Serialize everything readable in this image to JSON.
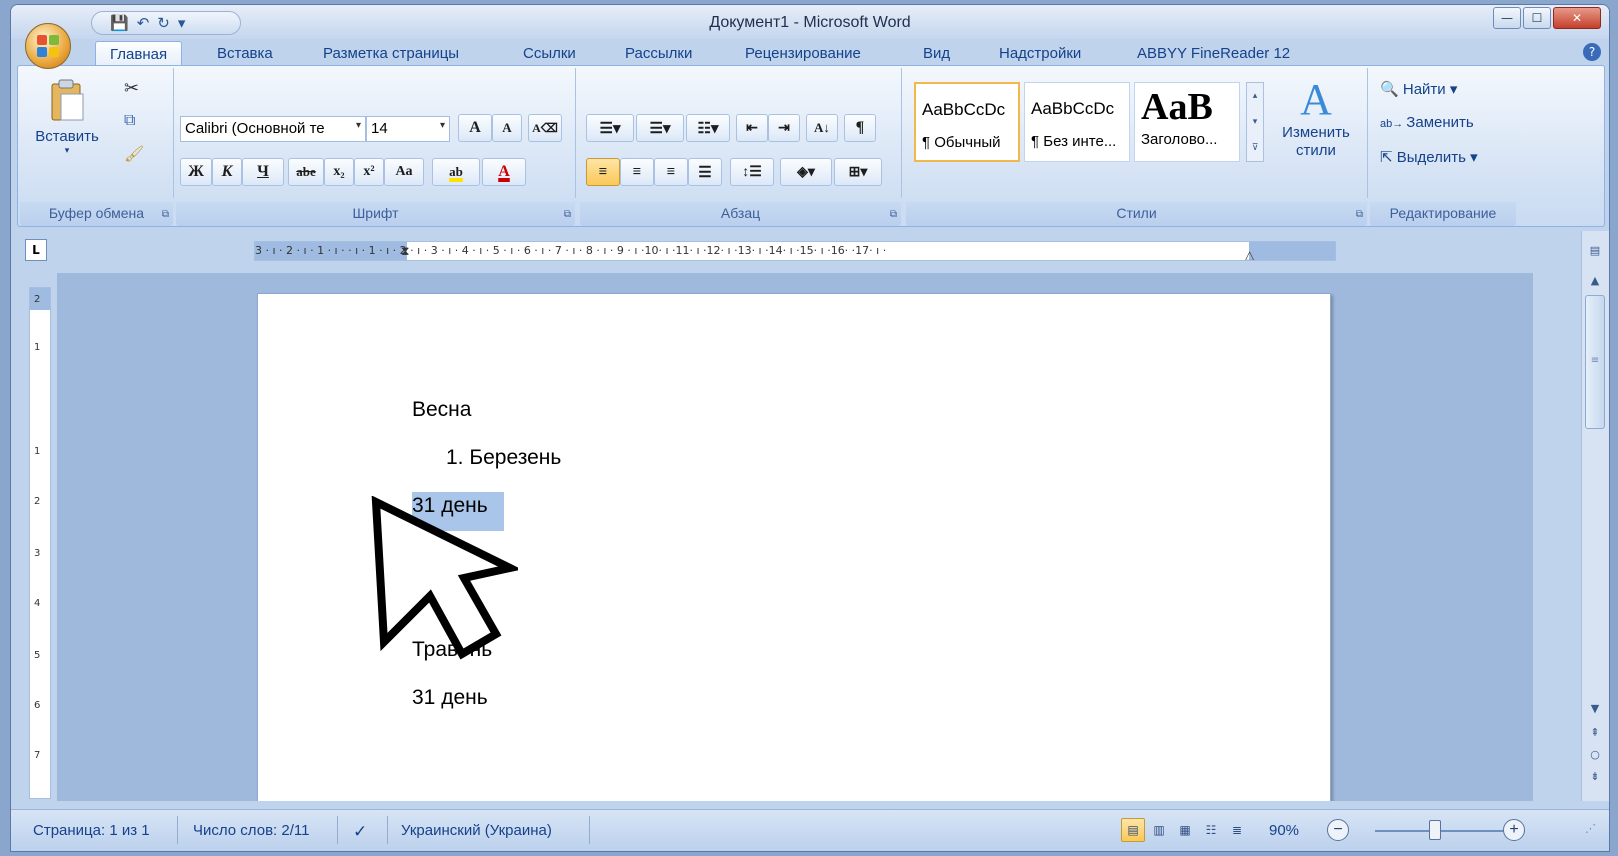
{
  "window": {
    "title": "Документ1 - Microsoft Word",
    "controls": {
      "minimize": "—",
      "maximize": "☐",
      "close": "✕"
    }
  },
  "quick_access": {
    "save": "💾",
    "undo": "↶",
    "redo": "↻",
    "more": "▾"
  },
  "tabs": [
    "Главная",
    "Вставка",
    "Разметка страницы",
    "Ссылки",
    "Рассылки",
    "Рецензирование",
    "Вид",
    "Надстройки",
    "ABBYY FineReader 12"
  ],
  "active_tab": "Главная",
  "help": "?",
  "ribbon": {
    "clipboard": {
      "label": "Буфер обмена",
      "paste": "Вставить"
    },
    "font": {
      "label": "Шрифт",
      "family": "Calibri (Основной те",
      "size": "14",
      "grow": "A",
      "shrink": "A",
      "bold": "Ж",
      "italic": "К",
      "underline": "Ч",
      "strike": "abe",
      "subscript": "x₂",
      "superscript": "x²",
      "case": "Aa",
      "highlight": "ab",
      "color": "A"
    },
    "paragraph": {
      "label": "Абзац",
      "show_marks": "¶"
    },
    "styles": {
      "label": "Стили",
      "tiles": [
        {
          "sample": "AaBbCcDc",
          "name": "¶ Обычный"
        },
        {
          "sample": "AaBbCcDc",
          "name": "¶ Без инте..."
        },
        {
          "sample": "AaB",
          "name": "Заголово..."
        }
      ],
      "change": "Изменить стили"
    },
    "editing": {
      "label": "Редактирование",
      "find": "Найти",
      "replace": "Заменить",
      "select": "Выделить"
    }
  },
  "ruler": {
    "tab_selector": "L",
    "marks": "3 · ı · 2 · ı · 1 · ı ·  · ı · 1 · ı · 2 · ı · 3 · ı · 4 · ı · 5 · ı · 6 · ı · 7 · ı · 8 · ı · 9 · ı ·10· ı ·11· ı ·12· ı ·13· ı ·14· ı ·15· ı ·16·  ·17· ı ·"
  },
  "vruler_marks": [
    "2",
    "1",
    "1",
    "2",
    "3",
    "4",
    "5",
    "6",
    "7"
  ],
  "document": {
    "paragraphs": [
      {
        "text": "Весна",
        "indent": false,
        "selected": false
      },
      {
        "text": "1.  Березень",
        "indent": true,
        "selected": false
      },
      {
        "text": "31 день",
        "indent": false,
        "selected": true
      },
      {
        "text": "Травень",
        "indent": false,
        "selected": false
      },
      {
        "text": "31 день",
        "indent": false,
        "selected": false
      }
    ]
  },
  "status": {
    "page": "Страница: 1 из 1",
    "words": "Число слов: 2/11",
    "language": "Украинский (Украина)",
    "zoom": "90%"
  },
  "colors": {
    "accent": "#15428b",
    "selection": "#a9c6ea",
    "active_button": "#fbc857"
  }
}
